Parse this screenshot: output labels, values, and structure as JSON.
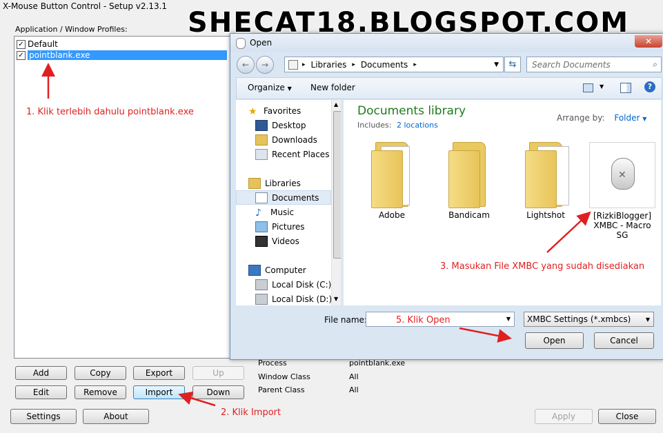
{
  "watermark": "SHECAT18.BLOGSPOT.COM",
  "xmbc": {
    "title": "X-Mouse Button Control - Setup v2.13.1",
    "profiles_label": "Application / Window Profiles:",
    "profiles": [
      {
        "label": "Default",
        "checked": true,
        "selected": false
      },
      {
        "label": "pointblank.exe",
        "checked": true,
        "selected": true
      }
    ],
    "buttons": {
      "add": "Add",
      "copy": "Copy",
      "export": "Export",
      "up": "Up",
      "edit": "Edit",
      "remove": "Remove",
      "import": "Import",
      "down": "Down",
      "settings": "Settings",
      "about": "About",
      "apply": "Apply",
      "close": "Close"
    },
    "details": [
      {
        "label": "Process",
        "value": "pointblank.exe"
      },
      {
        "label": "Window Class",
        "value": "All"
      },
      {
        "label": "Parent Class",
        "value": "All"
      }
    ]
  },
  "dialog": {
    "title": "Open",
    "breadcrumb": [
      "Libraries",
      "Documents"
    ],
    "search_placeholder": "Search Documents",
    "toolbar": {
      "organize": "Organize",
      "new_folder": "New folder"
    },
    "nav": {
      "favorites_header": "Favorites",
      "favorites": [
        "Desktop",
        "Downloads",
        "Recent Places"
      ],
      "libraries_header": "Libraries",
      "libraries": [
        "Documents",
        "Music",
        "Pictures",
        "Videos"
      ],
      "computer_header": "Computer",
      "computer": [
        "Local Disk (C:)",
        "Local Disk (D:)"
      ]
    },
    "library_title": "Documents library",
    "includes_label": "Includes:",
    "includes_link": "2 locations",
    "arrange_label": "Arrange by:",
    "arrange_value": "Folder",
    "files": [
      {
        "name": "Adobe",
        "type": "folder"
      },
      {
        "name": "Bandicam",
        "type": "folder"
      },
      {
        "name": "Lightshot",
        "type": "folder"
      },
      {
        "name": "[RizkiBlogger] XMBC - Macro SG",
        "type": "xmbc-file"
      }
    ],
    "file_name_label": "File name:",
    "file_name_value": "",
    "file_type": "XMBC Settings (*.xmbcs)",
    "open_button": "Open",
    "cancel_button": "Cancel"
  },
  "annotations": {
    "step1": "1. Klik terlebih dahulu pointblank.exe",
    "step2": "2. Klik Import",
    "step3": "3. Masukan File XMBC yang sudah disediakan",
    "step5": "5. Klik Open"
  },
  "colors": {
    "annotation": "#e02020",
    "selection": "#3399ff",
    "library_title": "#1e7b1e",
    "link": "#0066cc"
  }
}
